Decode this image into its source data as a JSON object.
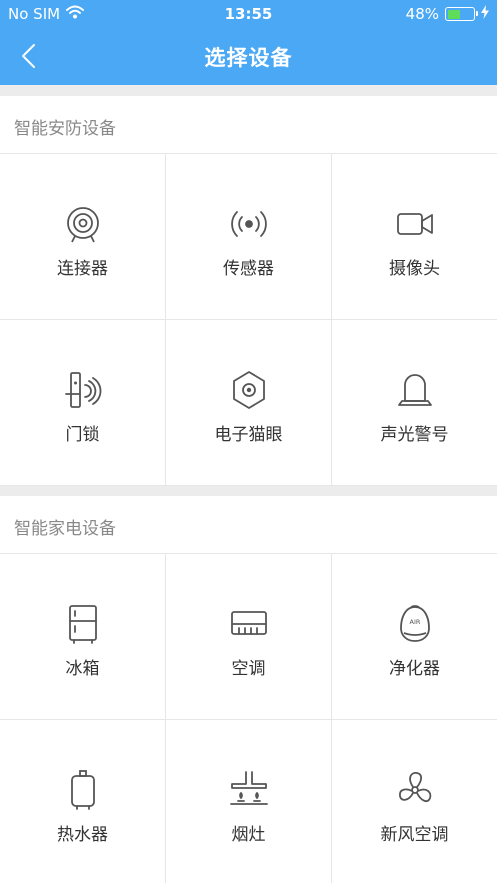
{
  "status_bar": {
    "carrier": "No SIM",
    "time": "13:55",
    "battery_percent": "48%",
    "battery_level": 0.48
  },
  "nav": {
    "title": "选择设备"
  },
  "sections": [
    {
      "title": "智能安防设备",
      "devices": [
        {
          "label": "连接器",
          "icon": "connector-icon"
        },
        {
          "label": "传感器",
          "icon": "sensor-icon"
        },
        {
          "label": "摄像头",
          "icon": "camera-icon"
        },
        {
          "label": "门锁",
          "icon": "door-lock-icon"
        },
        {
          "label": "电子猫眼",
          "icon": "peephole-icon"
        },
        {
          "label": "声光警号",
          "icon": "alarm-siren-icon"
        }
      ]
    },
    {
      "title": "智能家电设备",
      "devices": [
        {
          "label": "冰箱",
          "icon": "fridge-icon"
        },
        {
          "label": "空调",
          "icon": "air-conditioner-icon"
        },
        {
          "label": "净化器",
          "icon": "air-purifier-icon"
        },
        {
          "label": "热水器",
          "icon": "water-heater-icon"
        },
        {
          "label": "烟灶",
          "icon": "range-hood-stove-icon"
        },
        {
          "label": "新风空调",
          "icon": "fresh-air-fan-icon"
        }
      ]
    }
  ],
  "purifier_icon_text": "AIR",
  "colors": {
    "header": "#4aa8f4",
    "battery_fill": "#5fdc5a",
    "divider": "#e6e6e6",
    "section_gap": "#ececec"
  }
}
